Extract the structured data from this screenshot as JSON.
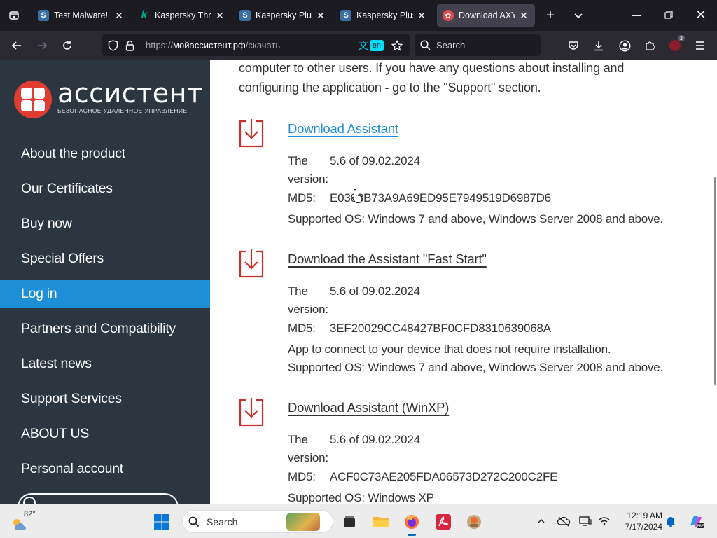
{
  "browser": {
    "tabs": [
      {
        "title": "Test Malware! - \\",
        "favicon": "S",
        "active": false
      },
      {
        "title": "Kaspersky Threa",
        "favicon": "k",
        "active": false
      },
      {
        "title": "Kaspersky Plus",
        "favicon": "S",
        "active": false
      },
      {
        "title": "Kaspersky Plus",
        "favicon": "S",
        "active": false
      },
      {
        "title": "Download AXYS",
        "favicon": "axys",
        "active": true
      }
    ],
    "url_prefix": "https://",
    "url_host": "мойассистент.рф",
    "url_path": "/скачать",
    "translate_lang": "en",
    "search_placeholder": "Search",
    "extension_badge": "3"
  },
  "site": {
    "logo_word": "ассистент",
    "logo_sub": "БЕЗОПАСНОЕ УДАЛЕННОЕ УПРАВЛЕНИЕ",
    "menu": [
      {
        "label": "About the product",
        "active": false
      },
      {
        "label": "Our Certificates",
        "active": false
      },
      {
        "label": "Buy now",
        "active": false
      },
      {
        "label": "Special Offers",
        "active": false
      },
      {
        "label": "Log in",
        "active": true
      },
      {
        "label": "Partners and Compatibility",
        "active": false
      },
      {
        "label": "Latest news",
        "active": false
      },
      {
        "label": "Support Services",
        "active": false
      },
      {
        "label": "ABOUT US",
        "active": false
      },
      {
        "label": "Personal account",
        "active": false
      }
    ],
    "intro": "computer to other users. If you have any questions about installing and configuring the application - go to the \"Support\" section.",
    "downloads": [
      {
        "title": "Download Assistant",
        "version_key": "The version:",
        "version_key_1": "The",
        "version_key_2": "version:",
        "version": "5.6 of 09.02.2024",
        "md5_key": "MD5:",
        "md5": "E0303B73A9A69ED95E7949519D6987D6",
        "note": "",
        "os": "Supported OS: Windows 7 and above, Windows Server 2008 and above."
      },
      {
        "title": "Download the Assistant \"Fast Start\"",
        "version_key_1": "The",
        "version_key_2": "version:",
        "version": "5.6 of 09.02.2024",
        "md5_key": "MD5:",
        "md5": "3EF20029CC48427BF0CFD8310639068A",
        "note": "App to connect to your device that does not require installation.",
        "os": "Supported OS: Windows 7 and above, Windows Server 2008 and above."
      },
      {
        "title": "Download Assistant (WinXP)",
        "version_key_1": "The",
        "version_key_2": "version:",
        "version": "5.6 of 09.02.2024",
        "md5_key": "MD5:",
        "md5": "ACF0C73AE205FDA06573D272C200C2FE",
        "note": "",
        "os": "Supported OS: Windows XP"
      }
    ]
  },
  "taskbar": {
    "temperature": "82°",
    "search_label": "Search",
    "time": "12:19 AM",
    "date": "7/17/2024"
  },
  "colors": {
    "sidebar_bg": "#2b3640",
    "accent_blue": "#1e8fd6",
    "logo_red": "#e03c31",
    "download_icon_red": "#c8322b"
  }
}
